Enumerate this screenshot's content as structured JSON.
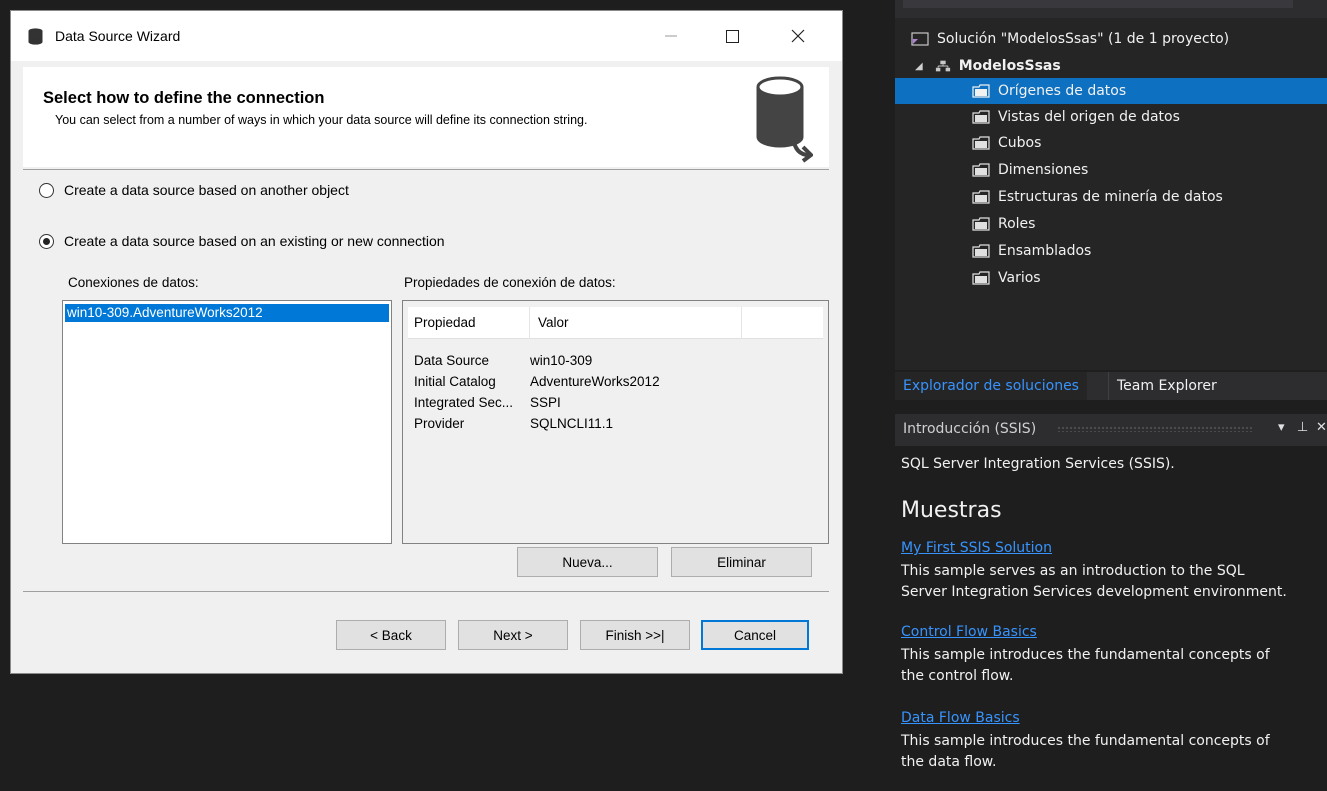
{
  "dialog": {
    "title": "Data Source Wizard",
    "header_title": "Select how to define the connection",
    "header_desc": "You can select from a number of ways in which your data source will define its connection string.",
    "option_other_object": "Create a data source based on another object",
    "option_existing_connection": "Create a data source based on an existing or new connection",
    "connections_label": "Conexiones de datos:",
    "properties_label": "Propiedades de conexión de datos:",
    "connections": [
      "win10-309.AdventureWorks2012"
    ],
    "prop_headers": {
      "property": "Propiedad",
      "value": "Valor"
    },
    "properties": [
      {
        "key": "Data Source",
        "value": "win10-309"
      },
      {
        "key": "Initial Catalog",
        "value": "AdventureWorks2012"
      },
      {
        "key": "Integrated Sec...",
        "value": "SSPI"
      },
      {
        "key": "Provider",
        "value": "SQLNCLI11.1"
      }
    ],
    "buttons": {
      "new": "Nueva...",
      "delete": "Eliminar",
      "back": "< Back",
      "next": "Next >",
      "finish": "Finish >>|",
      "cancel": "Cancel"
    }
  },
  "solution_explorer": {
    "solution": "Solución \"ModelosSsas\" (1 de 1 proyecto)",
    "project": "ModelosSsas",
    "folders": [
      "Orígenes de datos",
      "Vistas del origen de datos",
      "Cubos",
      "Dimensiones",
      "Estructuras de minería de datos",
      "Roles",
      "Ensamblados",
      "Varios"
    ],
    "selected_folder_index": 0,
    "tabs": [
      "Explorador de soluciones",
      "Team Explorer"
    ]
  },
  "intro_panel": {
    "title": "Introducción (SSIS)",
    "subtitle": "SQL Server Integration Services (SSIS).",
    "heading": "Muestras",
    "samples": [
      {
        "link": "My First SSIS Solution",
        "desc_1": "This sample serves as an introduction to the SQL",
        "desc_2": "Server Integration Services development environment."
      },
      {
        "link": "Control Flow Basics",
        "desc_1": "This sample introduces the fundamental concepts of",
        "desc_2": "the control flow."
      },
      {
        "link": "Data Flow Basics",
        "desc_1": "This sample introduces the fundamental concepts of",
        "desc_2": "the data flow."
      }
    ]
  },
  "colors": {
    "selection_blue": "#0078d7",
    "vs_selection": "#0e70c0",
    "link_blue": "#3794ff"
  }
}
